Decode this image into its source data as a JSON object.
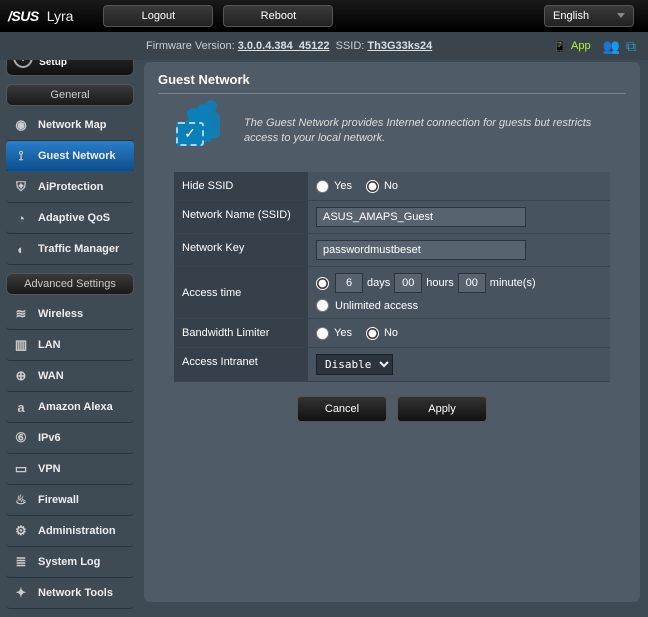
{
  "header": {
    "brand": "/SUS",
    "model": "Lyra",
    "logout": "Logout",
    "reboot": "Reboot",
    "language": "English"
  },
  "info": {
    "fw_label": "Firmware Version:",
    "fw_value": "3.0.0.4.384_45122",
    "ssid_label": "SSID:",
    "ssid_value": "Th3G33ks24",
    "app_label": "App"
  },
  "sidebar": {
    "qis": "Quick Internet Setup",
    "general_h": "General",
    "adv_h": "Advanced Settings",
    "general": [
      {
        "label": "Network Map",
        "icon": "◉"
      },
      {
        "label": "Guest Network",
        "icon": "⟟",
        "active": true
      },
      {
        "label": "AiProtection",
        "icon": "⛨"
      },
      {
        "label": "Adaptive QoS",
        "icon": "◔"
      },
      {
        "label": "Traffic Manager",
        "icon": "◐"
      }
    ],
    "advanced": [
      {
        "label": "Wireless",
        "icon": "≋"
      },
      {
        "label": "LAN",
        "icon": "▥"
      },
      {
        "label": "WAN",
        "icon": "⊕"
      },
      {
        "label": "Amazon Alexa",
        "icon": "a"
      },
      {
        "label": "IPv6",
        "icon": "⑥"
      },
      {
        "label": "VPN",
        "icon": "▭"
      },
      {
        "label": "Firewall",
        "icon": "♨"
      },
      {
        "label": "Administration",
        "icon": "⚙"
      },
      {
        "label": "System Log",
        "icon": "≣"
      },
      {
        "label": "Network Tools",
        "icon": "✦"
      }
    ]
  },
  "panel": {
    "title": "Guest Network",
    "intro": "The Guest Network provides Internet connection for guests but restricts access to your local network.",
    "rows": {
      "hide_ssid": {
        "label": "Hide SSID",
        "yes": "Yes",
        "no": "No",
        "value": "no"
      },
      "net_name": {
        "label": "Network Name (SSID)",
        "value": "ASUS_AMAPS_Guest"
      },
      "net_key": {
        "label": "Network Key",
        "value": "passwordmustbeset"
      },
      "access_time": {
        "label": "Access time",
        "mode": "limited",
        "days": "6",
        "days_l": "days",
        "hours": "00",
        "hours_l": "hours",
        "minutes": "00",
        "minutes_l": "minute(s)",
        "unlimited": "Unlimited access"
      },
      "bw_limit": {
        "label": "Bandwidth Limiter",
        "yes": "Yes",
        "no": "No",
        "value": "no"
      },
      "intranet": {
        "label": "Access Intranet",
        "value": "Disable"
      }
    },
    "buttons": {
      "cancel": "Cancel",
      "apply": "Apply"
    }
  }
}
